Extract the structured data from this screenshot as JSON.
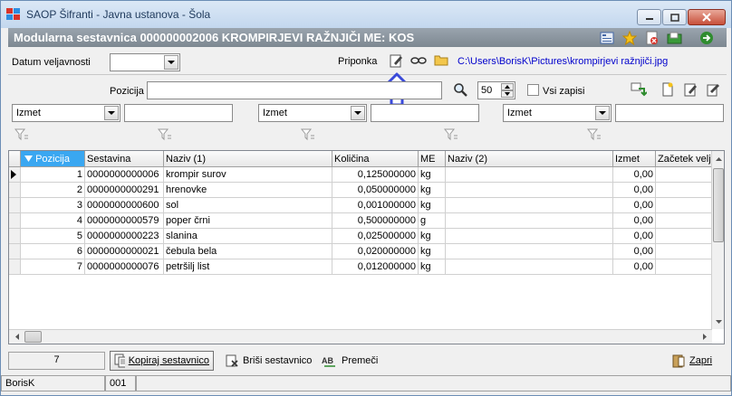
{
  "window": {
    "title": "SAOP Šifranti  - Javna ustanova - Šola"
  },
  "header": {
    "doc_title": "Modularna sestavnica 000000002006 KROMPIRJEVI RAŽNJIČI    ME: KOS"
  },
  "form": {
    "datum_label": "Datum veljavnosti",
    "priponka_label": "Priponka",
    "priponka_path": "C:\\Users\\BorisK\\Pictures\\krompirjevi ražnjiči.jpg",
    "pozicija_label": "Pozicija",
    "count_value": "50",
    "vsi_zapisi_label": "Vsi zapisi"
  },
  "filters": [
    {
      "value": "Izmet"
    },
    {
      "value": "Izmet"
    },
    {
      "value": "Izmet"
    }
  ],
  "table": {
    "columns": [
      "Pozicija",
      "Sestavina",
      "Naziv (1)",
      "Količina",
      "ME",
      "Naziv (2)",
      "Izmet",
      "Začetek velj"
    ],
    "rows": [
      {
        "pozicija": "1",
        "sestavina": "0000000000006",
        "naziv1": "krompir surov",
        "kolicina": "0,125000000",
        "me": "kg",
        "naziv2": "",
        "izmet": "0,00"
      },
      {
        "pozicija": "2",
        "sestavina": "0000000000291",
        "naziv1": "hrenovke",
        "kolicina": "0,050000000",
        "me": "kg",
        "naziv2": "",
        "izmet": "0,00"
      },
      {
        "pozicija": "3",
        "sestavina": "0000000000600",
        "naziv1": "sol",
        "kolicina": "0,001000000",
        "me": "kg",
        "naziv2": "",
        "izmet": "0,00"
      },
      {
        "pozicija": "4",
        "sestavina": "0000000000579",
        "naziv1": "poper črni",
        "kolicina": "0,500000000",
        "me": "g",
        "naziv2": "",
        "izmet": "0,00"
      },
      {
        "pozicija": "5",
        "sestavina": "0000000000223",
        "naziv1": "slanina",
        "kolicina": "0,025000000",
        "me": "kg",
        "naziv2": "",
        "izmet": "0,00"
      },
      {
        "pozicija": "6",
        "sestavina": "0000000000021",
        "naziv1": "čebula bela",
        "kolicina": "0,020000000",
        "me": "kg",
        "naziv2": "",
        "izmet": "0,00"
      },
      {
        "pozicija": "7",
        "sestavina": "0000000000076",
        "naziv1": "petršilj list",
        "kolicina": "0,012000000",
        "me": "kg",
        "naziv2": "",
        "izmet": "0,00"
      }
    ]
  },
  "footer": {
    "record_count": "7",
    "kopiraj_label": "Kopiraj sestavnico",
    "brisi_label": "Briši sestavnico",
    "premeci_label": "Premeči",
    "zapri_label": "Zapri"
  },
  "statusbar": {
    "user": "BorisK",
    "code": "001"
  },
  "colors": {
    "accent": "#3aa7f1",
    "doc_bar": "#8a949e",
    "link": "#0000cc",
    "annotation_arrow": "#3a4ad9"
  }
}
